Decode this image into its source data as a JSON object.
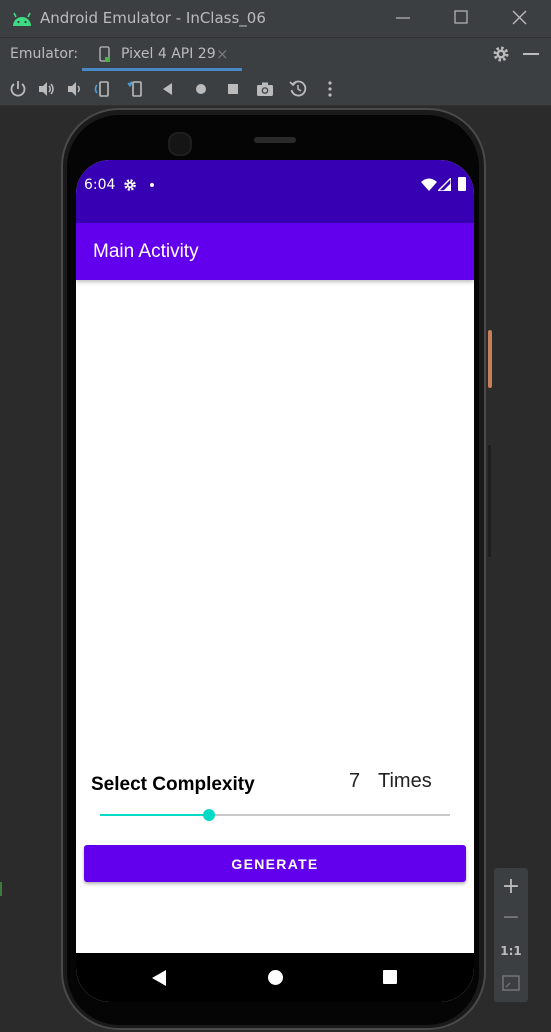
{
  "window": {
    "title": "Android Emulator - InClass_06"
  },
  "tabbar": {
    "label": "Emulator:",
    "tab_name": "Pixel 4 API 29",
    "close_glyph": "×"
  },
  "toolbar": {
    "icons": [
      "power-icon",
      "volume-up-icon",
      "volume-down-icon",
      "rotate-left-icon",
      "rotate-right-icon",
      "back-icon",
      "home-icon",
      "overview-icon",
      "camera-icon",
      "restore-icon",
      "more-icon"
    ]
  },
  "device": {
    "status": {
      "time": "6:04"
    },
    "app": {
      "title": "Main Activity"
    },
    "complexity": {
      "label": "Select Complexity",
      "count": "7",
      "unit": "Times",
      "slider_fraction": 0.31
    },
    "button": {
      "label": "GENERATE"
    }
  },
  "zoom": {
    "plus": "+",
    "minus": "−",
    "one_to_one": "1:1"
  },
  "colors": {
    "primary": "#6200ee",
    "primary_dark": "#3700b3",
    "accent": "#03dac5",
    "ide_panel": "#3c3f41",
    "ide_background": "#2b2b2b"
  }
}
